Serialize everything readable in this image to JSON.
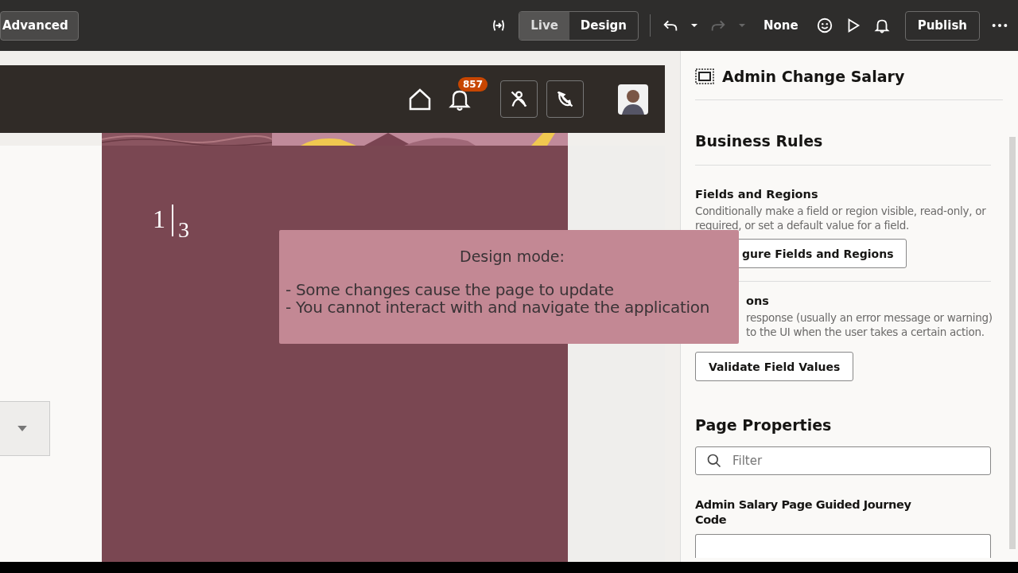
{
  "toolbar": {
    "advanced_label": "Advanced",
    "mode_tabs": [
      {
        "label": "Live",
        "selected": true
      },
      {
        "label": "Design",
        "selected": false
      }
    ],
    "redo_disabled": true,
    "redo_menu_disabled": true,
    "undo_disabled": false,
    "version_label": "None",
    "publish_label": "Publish"
  },
  "app_header": {
    "notification_count": "857"
  },
  "canvas": {
    "page_current": "1",
    "page_total": "3"
  },
  "design_notice": {
    "title": "Design mode:",
    "lines": [
      "- Some changes cause the page to update",
      "- You cannot interact with and navigate the application"
    ]
  },
  "panel": {
    "title": "Admin Change Salary",
    "section_title": "Business Rules",
    "rules": [
      {
        "heading": "Fields and Regions",
        "heading_hidden": false,
        "description_lines": [
          "Conditionally make a field or region visible, read-only, or",
          "required, or set a default value for a field."
        ],
        "hidden_lines": [
          false,
          false
        ],
        "button": "gure Fields and Regions",
        "button_hidden": true
      },
      {
        "heading": "ons",
        "heading_hidden": true,
        "description_lines": [
          "response (usually an error message or warning)",
          "to the UI when the user takes a certain action."
        ],
        "hidden_lines": [
          true,
          true
        ],
        "button": "Validate Field Values",
        "button_hidden": false
      }
    ],
    "properties_title": "Page Properties",
    "filter": {
      "placeholder": "Filter"
    },
    "property_label": "Admin Salary Page Guided Journey Code"
  }
}
